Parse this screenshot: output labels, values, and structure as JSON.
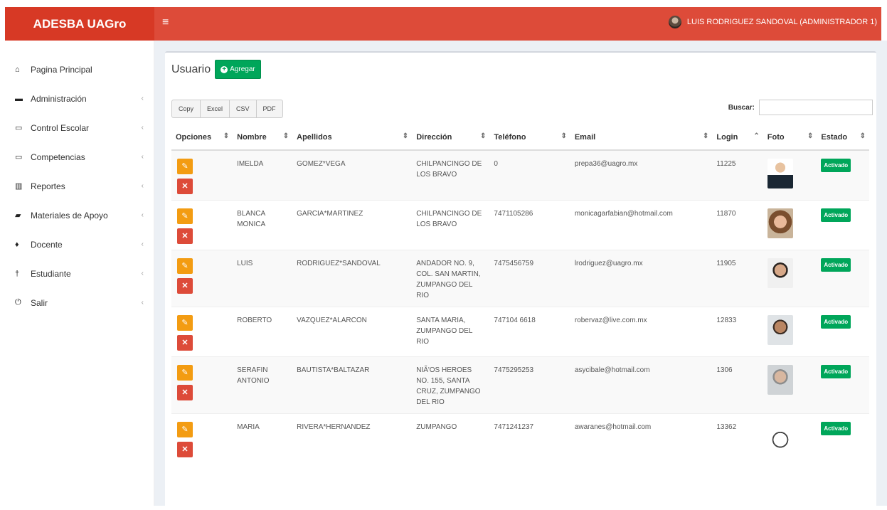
{
  "app": {
    "brand": "ADESBA UAGro",
    "user": "LUIS RODRIGUEZ SANDOVAL (ADMINISTRADOR 1)"
  },
  "sidebar": {
    "items": [
      {
        "label": "Pagina Principal",
        "icon": "home-icon",
        "glyph": "⌂",
        "chevron": false
      },
      {
        "label": "Administración",
        "icon": "folder-icon",
        "glyph": "▬",
        "chevron": true
      },
      {
        "label": "Control Escolar",
        "icon": "laptop-icon",
        "glyph": "▭",
        "chevron": true
      },
      {
        "label": "Competencias",
        "icon": "laptop-icon",
        "glyph": "▭",
        "chevron": true
      },
      {
        "label": "Reportes",
        "icon": "bar-chart-icon",
        "glyph": "▥",
        "chevron": true
      },
      {
        "label": "Materiales de Apoyo",
        "icon": "book-icon",
        "glyph": "▰",
        "chevron": true
      },
      {
        "label": "Docente",
        "icon": "person-icon",
        "glyph": "♦",
        "chevron": true
      },
      {
        "label": "Estudiante",
        "icon": "person-icon",
        "glyph": "†",
        "chevron": true
      },
      {
        "label": "Salir",
        "icon": "power-icon",
        "glyph": "⏻",
        "chevron": true
      }
    ]
  },
  "page": {
    "title": "Usuario",
    "add_label": "Agregar"
  },
  "toolbar": {
    "buttons": [
      "Copy",
      "Excel",
      "CSV",
      "PDF"
    ],
    "search_label": "Buscar:",
    "search_value": ""
  },
  "table": {
    "headers": [
      "Opciones",
      "Nombre",
      "Apellidos",
      "Dirección",
      "Teléfono",
      "Email",
      "Login",
      "Foto",
      "Estado"
    ],
    "rows": [
      {
        "nombre": "IMELDA",
        "apellidos": "GOMEZ*VEGA",
        "direccion": "CHILPANCINGO DE LOS BRAVO",
        "telefono": "0",
        "email": "prepa36@uagro.mx",
        "login": "11225",
        "estado": "Activado"
      },
      {
        "nombre": "BLANCA MONICA",
        "apellidos": "GARCIA*MARTINEZ",
        "direccion": "CHILPANCINGO DE LOS BRAVO",
        "telefono": "7471105286",
        "email": "monicagarfabian@hotmail.com",
        "login": "11870",
        "estado": "Activado"
      },
      {
        "nombre": "LUIS",
        "apellidos": "RODRIGUEZ*SANDOVAL",
        "direccion": "ANDADOR NO. 9, COL. SAN MARTIN, ZUMPANGO DEL RIO",
        "telefono": "7475456759",
        "email": "lrodriguez@uagro.mx",
        "login": "11905",
        "estado": "Activado"
      },
      {
        "nombre": "ROBERTO",
        "apellidos": "VAZQUEZ*ALARCON",
        "direccion": "SANTA MARIA, ZUMPANGO DEL RIO",
        "telefono": "747104 6618",
        "email": "robervaz@live.com.mx",
        "login": "12833",
        "estado": "Activado"
      },
      {
        "nombre": "SERAFIN ANTONIO",
        "apellidos": "BAUTISTA*BALTAZAR",
        "direccion": "NIÃ'OS HEROES NO. 155, SANTA CRUZ, ZUMPANGO DEL RIO",
        "telefono": "7475295253",
        "email": "asycibale@hotmail.com",
        "login": "1306",
        "estado": "Activado"
      },
      {
        "nombre": "MARIA",
        "apellidos": "RIVERA*HERNANDEZ",
        "direccion": "ZUMPANGO",
        "telefono": "7471241237",
        "email": "awaranes@hotmail.com",
        "login": "13362",
        "estado": "Activado"
      }
    ]
  }
}
